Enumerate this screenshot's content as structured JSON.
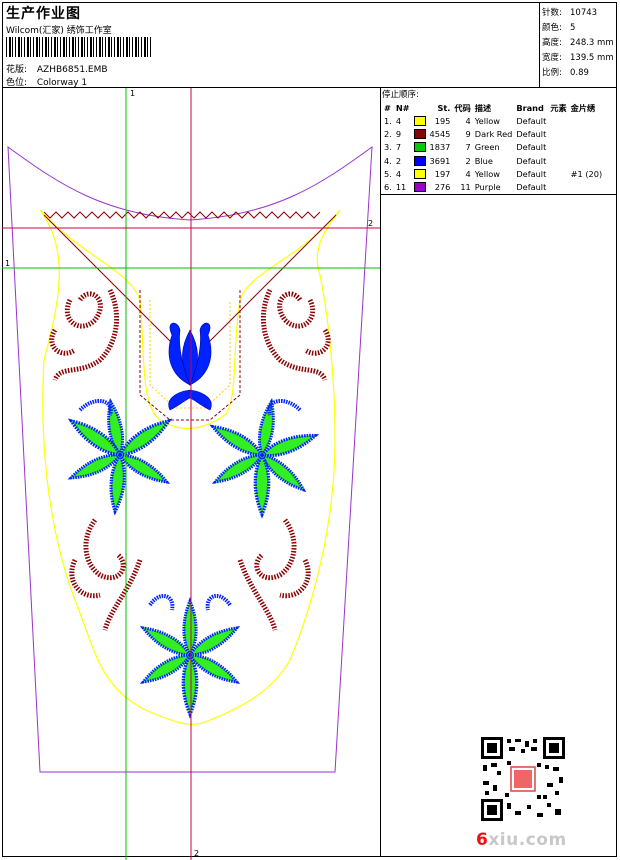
{
  "header": {
    "title": "生产作业图",
    "company": "Wilcom(汇家) 绣饰工作室",
    "design_label": "花版:",
    "design_value": "AZHB6851.EMB",
    "colorway_label": "色位:",
    "colorway_value": "Colorway 1"
  },
  "stats": [
    {
      "label": "针数:",
      "value": "10743"
    },
    {
      "label": "颜色:",
      "value": "5"
    },
    {
      "label": "高度:",
      "value": "248.3 mm"
    },
    {
      "label": "宽度:",
      "value": "139.5 mm"
    },
    {
      "label": "比例:",
      "value": "0.89"
    }
  ],
  "stop_sequence": {
    "heading": "停止顺序:",
    "columns": [
      "#",
      "N#",
      "St.",
      "代码",
      "描述",
      "Brand",
      "元素",
      "金片绣"
    ],
    "rows": [
      {
        "idx": "1.",
        "n": "4",
        "color": "#ffff00",
        "st": "195",
        "code": "4",
        "desc": "Yellow",
        "brand": "Default",
        "elem": "",
        "seq": ""
      },
      {
        "idx": "2.",
        "n": "9",
        "color": "#8b0000",
        "st": "4545",
        "code": "9",
        "desc": "Dark Red",
        "brand": "Default",
        "elem": "",
        "seq": ""
      },
      {
        "idx": "3.",
        "n": "7",
        "color": "#00cc00",
        "st": "1837",
        "code": "7",
        "desc": "Green",
        "brand": "Default",
        "elem": "",
        "seq": ""
      },
      {
        "idx": "4.",
        "n": "2",
        "color": "#0000ff",
        "st": "3691",
        "code": "2",
        "desc": "Blue",
        "brand": "Default",
        "elem": "",
        "seq": ""
      },
      {
        "idx": "5.",
        "n": "4",
        "color": "#ffff00",
        "st": "197",
        "code": "4",
        "desc": "Yellow",
        "brand": "Default",
        "elem": "",
        "seq": "#1 (20)"
      },
      {
        "idx": "6.",
        "n": "11",
        "color": "#9900cc",
        "st": "276",
        "code": "11",
        "desc": "Purple",
        "brand": "Default",
        "elem": "",
        "seq": ""
      }
    ]
  },
  "guides": {
    "v1": "1",
    "v2": "2",
    "h1": "1",
    "h2": "2"
  },
  "colors": {
    "yellow": "#ffff00",
    "darkred": "#8b0000",
    "green": "#33ee22",
    "blue": "#0022ff",
    "purple": "#9933cc",
    "guide_red": "#cc0044",
    "guide_green": "#00bb00"
  },
  "watermark": {
    "digit": "6",
    "rest": "xiu.com"
  }
}
